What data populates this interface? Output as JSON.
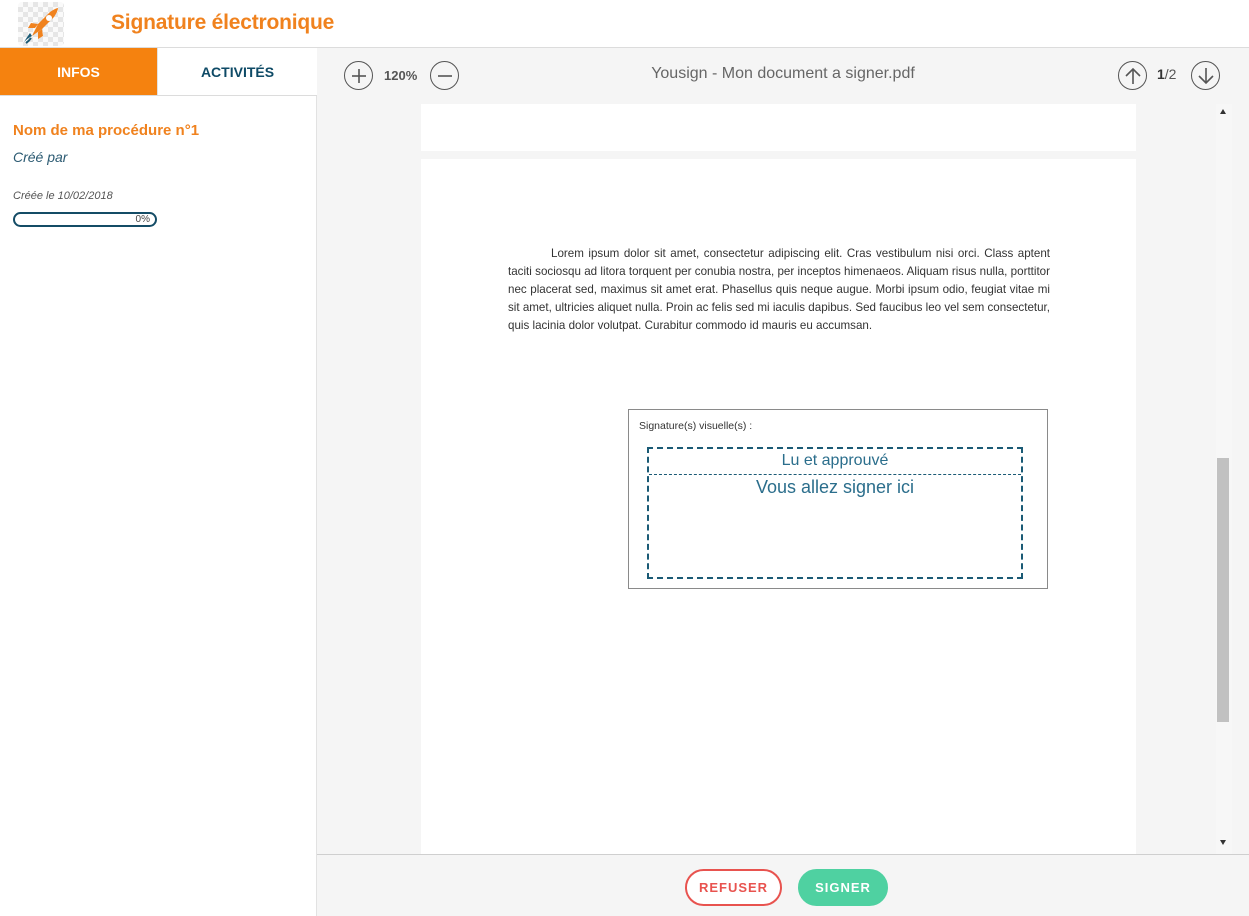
{
  "app": {
    "title": "Signature électronique"
  },
  "sidebar": {
    "tabs": [
      {
        "label": "INFOS",
        "active": true
      },
      {
        "label": "ACTIVITÉS",
        "active": false
      }
    ],
    "procedure_name": "Nom de ma procédure n°1",
    "created_by": "Créé par",
    "created_on": "Créée le 10/02/2018",
    "progress": {
      "percent": 0,
      "label": "0%"
    }
  },
  "toolbar": {
    "zoom_in_icon": "plus-circle-icon",
    "zoom_level": "120%",
    "zoom_out_icon": "minus-circle-icon",
    "document_title": "Yousign - Mon document a signer.pdf",
    "page_up_icon": "arrow-up-circle-icon",
    "page_current": "1",
    "page_total": "/2",
    "page_down_icon": "arrow-down-circle-icon"
  },
  "document": {
    "body_text": "Lorem ipsum dolor sit amet, consectetur adipiscing elit. Cras vestibulum nisi orci. Class aptent taciti sociosqu ad litora torquent per conubia nostra, per inceptos himenaeos. Aliquam risus nulla, porttitor nec placerat sed, maximus sit amet erat. Phasellus quis neque augue. Morbi ipsum odio, feugiat vitae mi sit amet, ultricies aliquet nulla. Proin ac felis sed mi iaculis dapibus. Sed faucibus leo vel sem consectetur, quis lacinia dolor volutpat. Curabitur commodo id mauris eu accumsan.",
    "signature_box_label": "Signature(s) visuelle(s) :",
    "signature_mention": "Lu et approuvé",
    "signature_placeholder": "Vous allez signer ici"
  },
  "footer": {
    "refuse_label": "REFUSER",
    "sign_label": "SIGNER"
  },
  "colors": {
    "brand_orange": "#f0821e",
    "tab_active": "#f5820f",
    "navy": "#144c66",
    "refuse_red": "#e8534f",
    "sign_green": "#4fd1a1"
  }
}
